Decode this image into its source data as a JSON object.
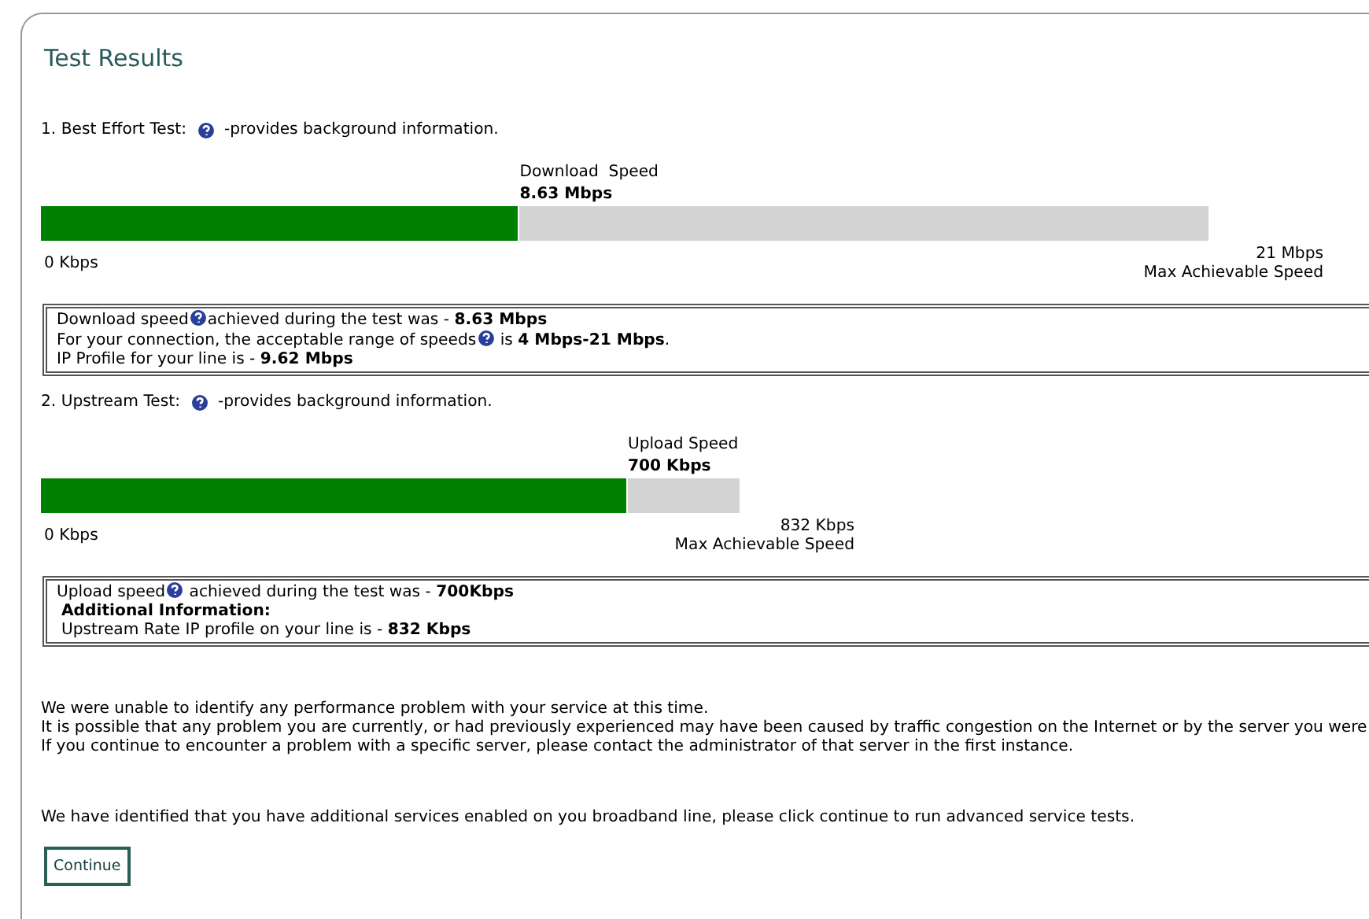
{
  "title": "Test Results",
  "tests": [
    {
      "heading": "1. Best Effort Test:",
      "note": "-provides background information.",
      "meter_label": "Download  Speed",
      "reading": "8.63 Mbps",
      "level": 0.41,
      "min": "0 Kbps",
      "max": "21 Mbps",
      "max_caption": "Max Achievable Speed",
      "lines": [
        {
          "kind": "text",
          "text": "Download speed",
          "help": true,
          "after": "achieved during the test was - **8.63 Mbps**"
        },
        {
          "kind": "text",
          "text": "For your connection, the acceptable range of speeds",
          "help": true,
          "after": " is **4 Mbps-21 Mbps**."
        },
        {
          "kind": "text",
          "text": "IP Profile for your line is - **9.62 Mbps**",
          "help": false
        }
      ]
    },
    {
      "heading": "2. Upstream Test:",
      "note": "-provides background information.",
      "meter_label": "Upload Speed",
      "reading": "700 Kbps",
      "level": 0.84,
      "min": "0 Kbps",
      "max": "832 Kbps",
      "max_caption": "Max Achievable Speed",
      "lines": [
        {
          "kind": "text",
          "text": "Upload speed",
          "help": true,
          "after": " achieved during the test was - **700Kbps**"
        },
        {
          "kind": "heading",
          "text": "Additional Information:",
          "help": false
        },
        {
          "kind": "indented",
          "text": "Upstream Rate IP profile on your line is - **832 Kbps**",
          "help": false
        }
      ]
    }
  ],
  "messages": [
    "We were unable to identify any performance problem with your service at this time.",
    "It is possible that any problem you are currently, or had previously experienced may have been caused by traffic congestion on the Internet or by the server you were",
    "If you continue to encounter a problem with a specific server, please contact the administrator of that server in the first instance."
  ],
  "notice": "We have identified that you have additional services enabled on you broadband line, please click continue to run advanced service tests.",
  "button": "Continue"
}
